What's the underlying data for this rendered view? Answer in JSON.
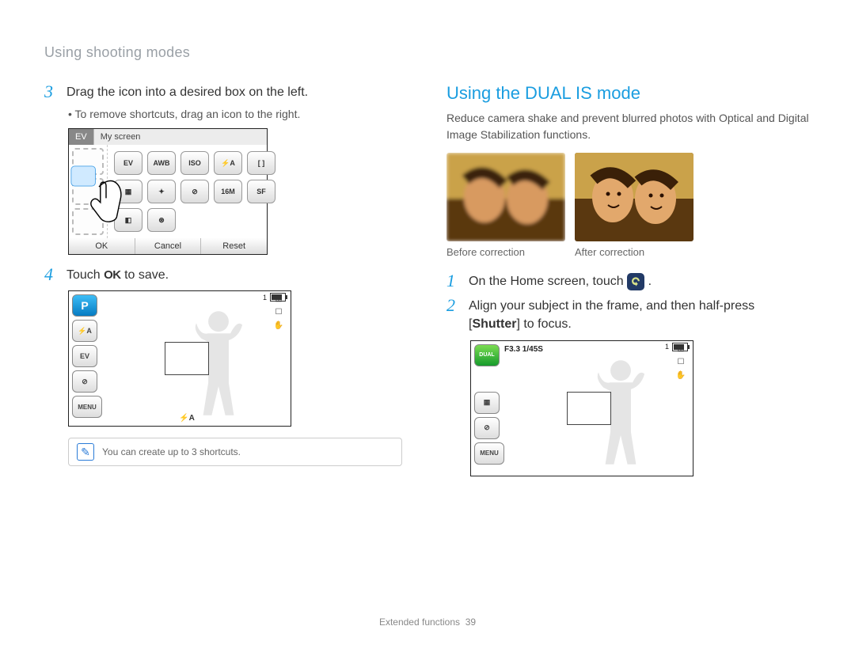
{
  "header": {
    "running_title": "Using shooting modes"
  },
  "left": {
    "step3": {
      "num": "3",
      "text": "Drag the icon into a desired box on the left.",
      "sub": "To remove shortcuts, drag an icon to the right."
    },
    "lcd1": {
      "tab_ev": "EV",
      "tab_title": "My screen",
      "btn_ok": "OK",
      "btn_cancel": "Cancel",
      "btn_reset": "Reset",
      "icons": [
        "EV",
        "AWB",
        "ISO",
        "⚡A",
        "[ ]",
        "▦",
        "✦",
        "⊘",
        "16M",
        "SF",
        "◧",
        "⊛",
        "—",
        "—",
        "—"
      ]
    },
    "step4": {
      "num": "4",
      "pre": "Touch ",
      "ok": "OK",
      "post": " to save."
    },
    "lcd2": {
      "count": "1",
      "pills": [
        "P",
        "⚡A",
        "EV",
        "⊘",
        "MENU"
      ],
      "flash_indicator": "⚡A",
      "right_icons": [
        "▥",
        "☐",
        "✋"
      ]
    },
    "note": {
      "text": "You can create up to 3 shortcuts."
    }
  },
  "right": {
    "title": "Using the DUAL IS mode",
    "intro": "Reduce camera shake and prevent blurred photos with Optical and Digital Image Stabilization functions.",
    "cap_before": "Before correction",
    "cap_after": "After correction",
    "step1": {
      "num": "1",
      "pre": "On the Home screen, touch ",
      "post": "."
    },
    "step2": {
      "num": "2",
      "line1_pre": "Align your subject in the frame, and then half-press ",
      "line2_pre": "[",
      "shutter": "Shutter",
      "line2_post": "] to focus."
    },
    "lcd2": {
      "count": "1",
      "exposure": "F3.3   1/45S",
      "pills": [
        "DUAL",
        "▦",
        "⊘",
        "MENU"
      ],
      "right_icons": [
        "▥",
        "☐",
        "✋"
      ]
    }
  },
  "footer": {
    "section": "Extended functions",
    "page": "39"
  }
}
